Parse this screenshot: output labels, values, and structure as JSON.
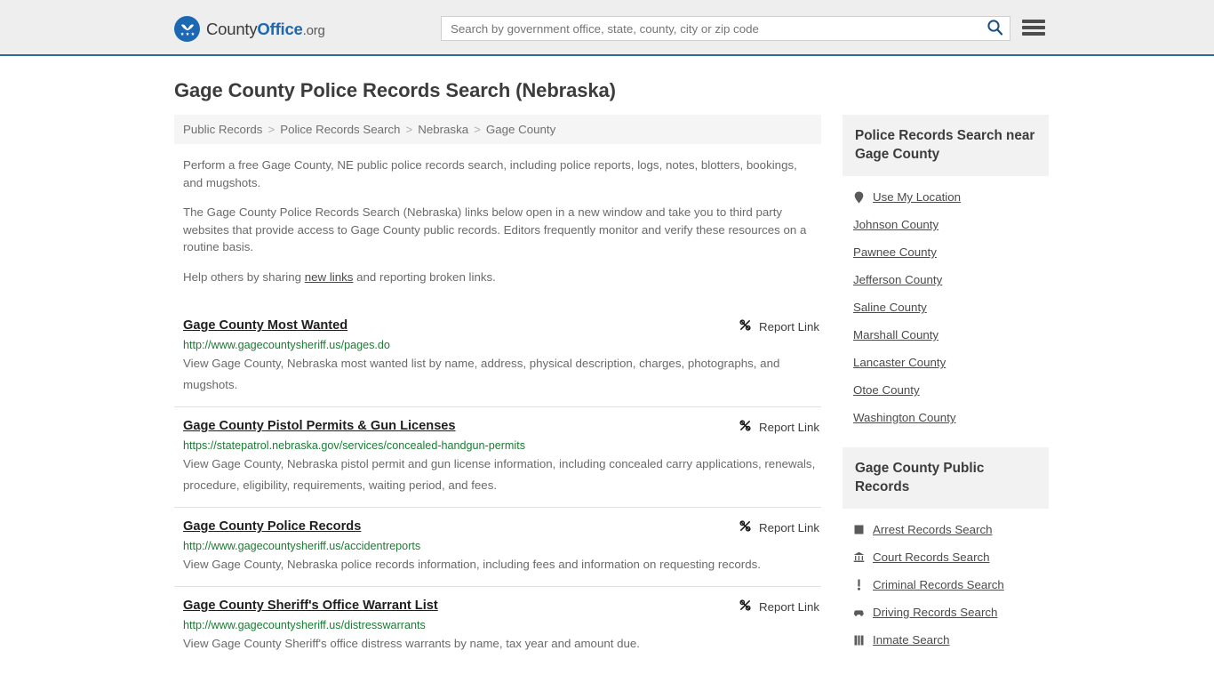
{
  "header": {
    "brand_name_part1": "County",
    "brand_name_part2": "Office",
    "brand_name_part3": ".org",
    "search_placeholder": "Search by government office, state, county, city or zip code",
    "search_value": "",
    "search_icon": "search-icon",
    "menu_icon": "hamburger-menu-icon",
    "accent_color": "#2c6aa0",
    "bg_color": "#eeeeee"
  },
  "page": {
    "title": "Gage County Police Records Search (Nebraska)"
  },
  "breadcrumb": {
    "items": [
      {
        "label": "Public Records"
      },
      {
        "label": "Police Records Search"
      },
      {
        "label": "Nebraska"
      },
      {
        "label": "Gage County"
      }
    ],
    "separator": ">"
  },
  "intro": {
    "paragraph1": "Perform a free Gage County, NE public police records search, including police reports, logs, notes, blotters, bookings, and mugshots.",
    "paragraph2": "The Gage County Police Records Search (Nebraska) links below open in a new window and take you to third party websites that provide access to Gage County public records. Editors frequently monitor and verify these resources on a routine basis.",
    "paragraph3_before": "Help others by sharing ",
    "paragraph3_link": "new links",
    "paragraph3_after": " and reporting broken links."
  },
  "results": {
    "report_label": "Report Link",
    "report_icon": "broken-link-icon",
    "items": [
      {
        "title": "Gage County Most Wanted",
        "url": "http://www.gagecountysheriff.us/pages.do",
        "description": "View Gage County, Nebraska most wanted list by name, address, physical description, charges, photographs, and mugshots."
      },
      {
        "title": "Gage County Pistol Permits & Gun Licenses",
        "url": "https://statepatrol.nebraska.gov/services/concealed-handgun-permits",
        "description": "View Gage County, Nebraska pistol permit and gun license information, including concealed carry applications, renewals, procedure, eligibility, requirements, waiting period, and fees."
      },
      {
        "title": "Gage County Police Records",
        "url": "http://www.gagecountysheriff.us/accidentreports",
        "description": "View Gage County, Nebraska police records information, including fees and information on requesting records."
      },
      {
        "title": "Gage County Sheriff's Office Warrant List",
        "url": "http://www.gagecountysheriff.us/distresswarrants",
        "description": "View Gage County Sheriff's office distress warrants by name, tax year and amount due."
      }
    ]
  },
  "sidebar": {
    "nearby": {
      "heading": "Police Records Search near Gage County",
      "items": [
        {
          "label": "Use My Location",
          "icon": "map-pin-icon"
        },
        {
          "label": "Johnson County",
          "icon": ""
        },
        {
          "label": "Pawnee County",
          "icon": ""
        },
        {
          "label": "Jefferson County",
          "icon": ""
        },
        {
          "label": "Saline County",
          "icon": ""
        },
        {
          "label": "Marshall County",
          "icon": ""
        },
        {
          "label": "Lancaster County",
          "icon": ""
        },
        {
          "label": "Otoe County",
          "icon": ""
        },
        {
          "label": "Washington County",
          "icon": ""
        }
      ]
    },
    "public_records": {
      "heading": "Gage County Public Records",
      "items": [
        {
          "label": "Arrest Records Search",
          "icon": "square-icon"
        },
        {
          "label": "Court Records Search",
          "icon": "courthouse-icon"
        },
        {
          "label": "Criminal Records Search",
          "icon": "exclamation-icon"
        },
        {
          "label": "Driving Records Search",
          "icon": "car-icon"
        },
        {
          "label": "Inmate Search",
          "icon": "jail-icon"
        }
      ]
    }
  }
}
